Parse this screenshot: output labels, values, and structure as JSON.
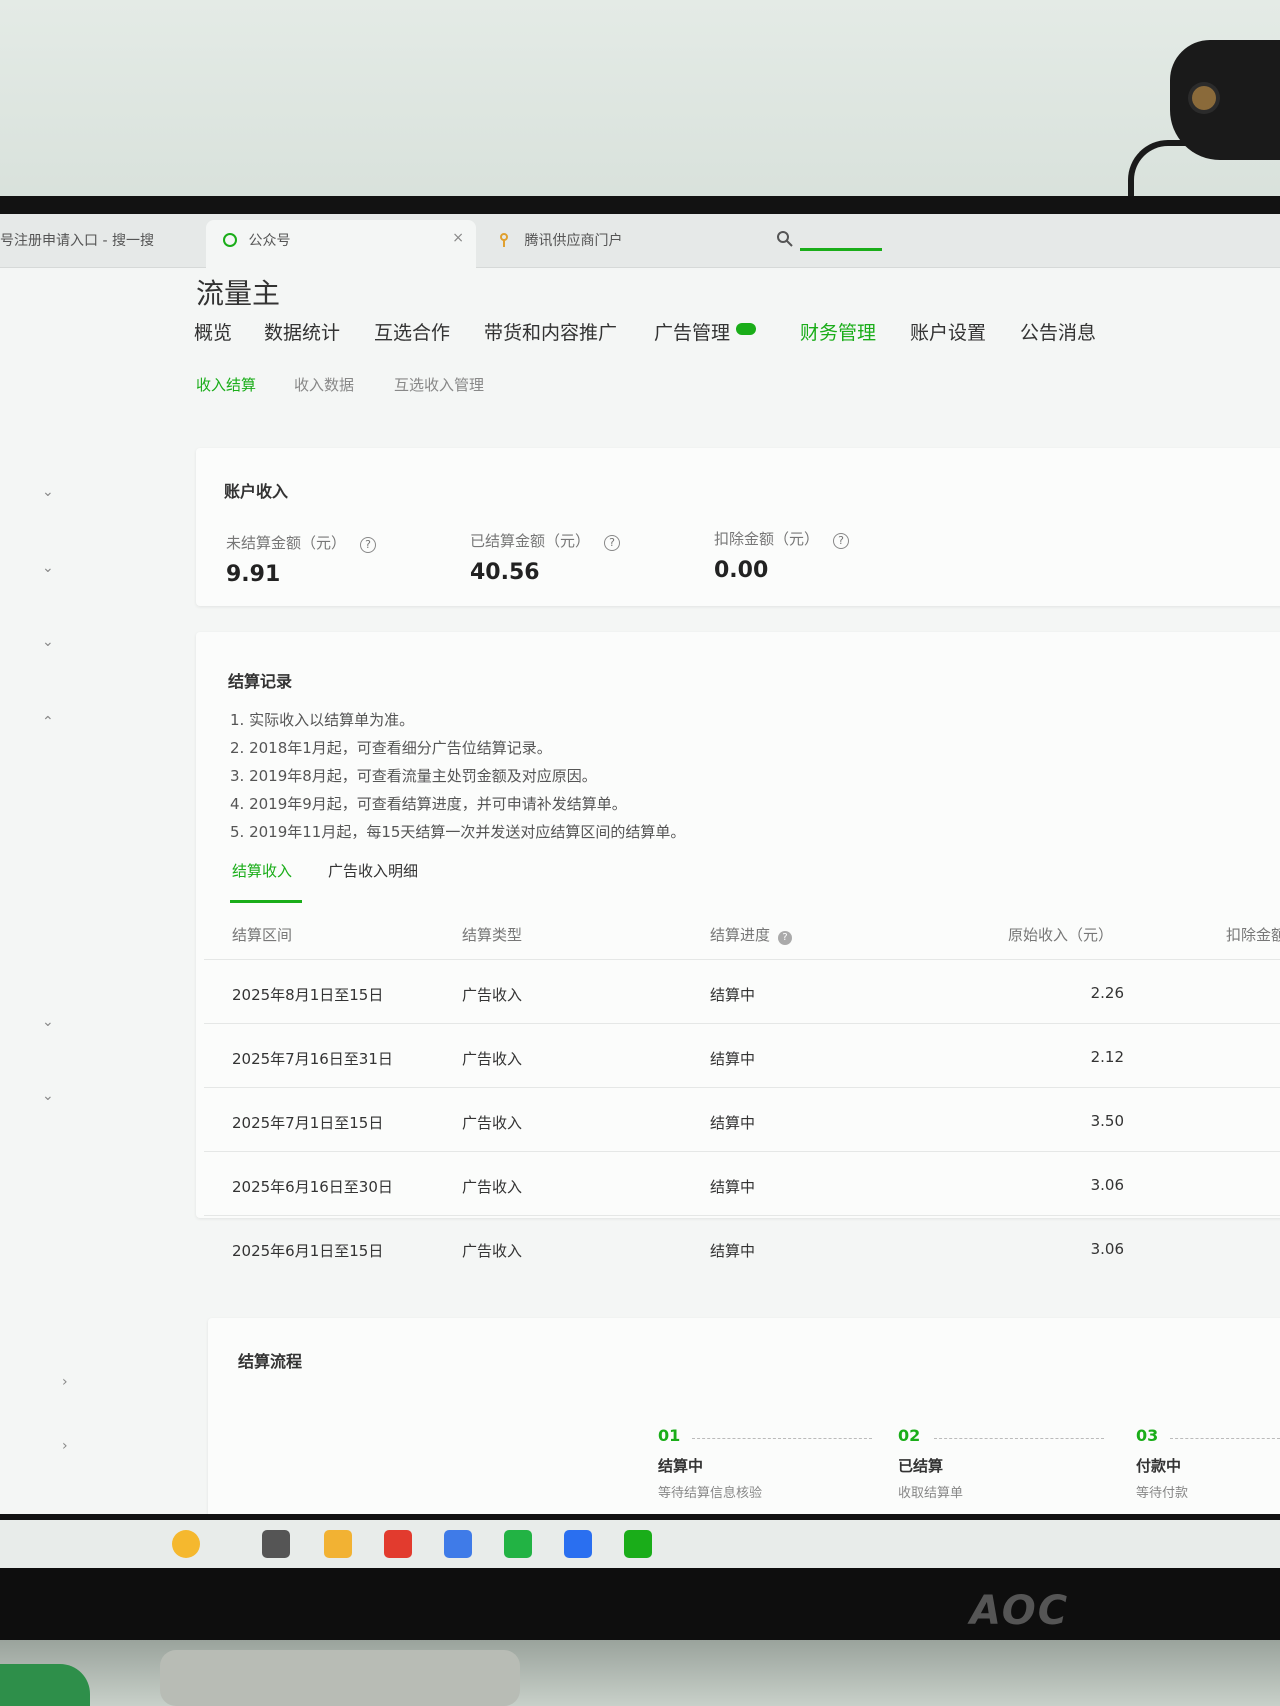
{
  "browser": {
    "tabs": [
      {
        "label": "号注册申请入口 - 搜一搜"
      },
      {
        "label": "公众号"
      },
      {
        "label": "腾讯供应商门户"
      }
    ],
    "close_glyph": "×"
  },
  "brand": "流量主",
  "nav": {
    "items": [
      "概览",
      "数据统计",
      "互选合作",
      "带货和内容推广",
      "广告管理",
      "财务管理",
      "账户设置",
      "公告消息"
    ]
  },
  "subnav": {
    "items": [
      "收入结算",
      "收入数据",
      "互选收入管理"
    ]
  },
  "account": {
    "title": "账户收入",
    "metrics": [
      {
        "label": "未结算金额（元）",
        "value": "9.91"
      },
      {
        "label": "已结算金额（元）",
        "value": "40.56"
      },
      {
        "label": "扣除金额（元）",
        "value": "0.00"
      }
    ]
  },
  "records": {
    "title": "结算记录",
    "notes": [
      "1. 实际收入以结算单为准。",
      "2. 2018年1月起，可查看细分广告位结算记录。",
      "3. 2019年8月起，可查看流量主处罚金额及对应原因。",
      "4. 2019年9月起，可查看结算进度，并可申请补发结算单。",
      "5. 2019年11月起，每15天结算一次并发送对应结算区间的结算单。"
    ],
    "tabs": [
      "结算收入",
      "广告收入明细"
    ],
    "columns": [
      "结算区间",
      "结算类型",
      "结算进度",
      "原始收入（元）",
      "扣除金额"
    ],
    "rows": [
      {
        "period": "2025年8月1日至15日",
        "type": "广告收入",
        "status": "结算中",
        "income": "2.26"
      },
      {
        "period": "2025年7月16日至31日",
        "type": "广告收入",
        "status": "结算中",
        "income": "2.12"
      },
      {
        "period": "2025年7月1日至15日",
        "type": "广告收入",
        "status": "结算中",
        "income": "3.50"
      },
      {
        "period": "2025年6月16日至30日",
        "type": "广告收入",
        "status": "结算中",
        "income": "3.06"
      },
      {
        "period": "2025年6月1日至15日",
        "type": "广告收入",
        "status": "结算中",
        "income": "3.06"
      }
    ]
  },
  "flow": {
    "title": "结算流程",
    "steps": [
      {
        "num": "01",
        "name": "结算中",
        "desc": "等待结算信息核验"
      },
      {
        "num": "02",
        "name": "已结算",
        "desc": "收取结算单"
      },
      {
        "num": "03",
        "name": "付款中",
        "desc": "等待付款"
      }
    ]
  },
  "monitor_logo": "AOC",
  "colors": {
    "accent": "#1aad19"
  }
}
